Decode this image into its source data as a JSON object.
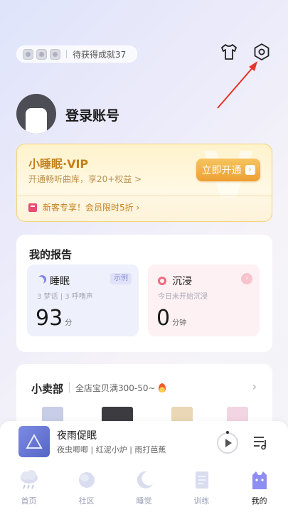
{
  "header": {
    "achievement_text": "待获得成就37",
    "badges": [
      "sheep-badge",
      "cat-badge",
      "dog-badge"
    ]
  },
  "profile": {
    "login_label": "登录账号"
  },
  "vip": {
    "title": "小睡眠·VIP",
    "subtitle": "开通畅听曲库，享20+权益 >",
    "cta_label": "立即开通",
    "promo_text": "新客专享！会员限时5折 ›",
    "watermark": "V"
  },
  "report": {
    "title": "我的报告",
    "sleep": {
      "label": "睡眠",
      "tag": "示例",
      "meta": "3 梦话 | 3 呼噜声",
      "value": "93",
      "unit": "分"
    },
    "immerse": {
      "label": "沉浸",
      "meta": "今日未开始沉浸",
      "value": "0",
      "unit": "分钟"
    }
  },
  "shop": {
    "title": "小卖部",
    "subtitle": "全店宝贝满300-50~"
  },
  "player": {
    "title": "夜雨促眠",
    "subtitle": "夜虫唧唧 | 红泥小炉 | 雨打芭蕉"
  },
  "tabs": [
    {
      "label": "首页",
      "icon": "cloud-rain-icon"
    },
    {
      "label": "社区",
      "icon": "planet-icon"
    },
    {
      "label": "睡觉",
      "icon": "moon-icon"
    },
    {
      "label": "训练",
      "icon": "notebook-icon"
    },
    {
      "label": "我的",
      "icon": "cat-icon"
    }
  ],
  "colors": {
    "vip_gold": "#c47f1a",
    "accent_purple": "#7f86e6",
    "immerse_red": "#ef6b7f",
    "annotation_red": "#e8332b"
  }
}
